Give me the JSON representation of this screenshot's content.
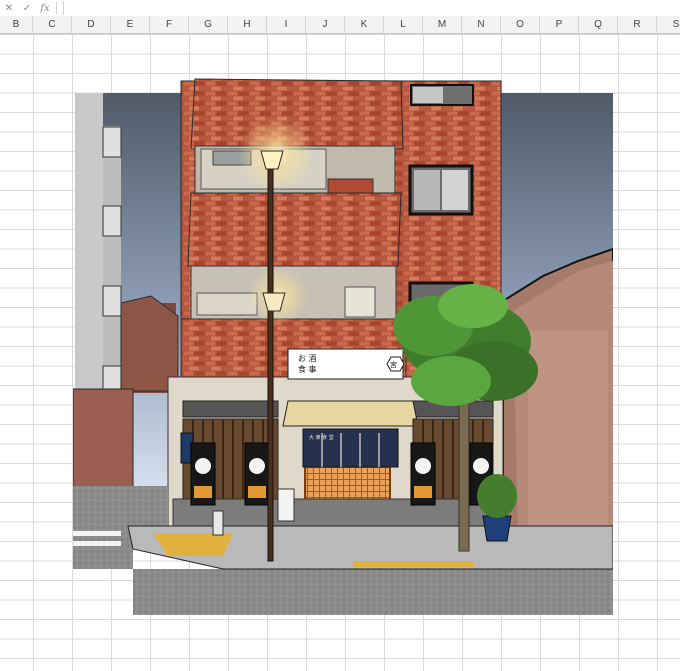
{
  "formula_bar": {
    "cancel_icon": "close-icon",
    "cancel_glyph": "✕",
    "confirm_icon": "check-icon",
    "confirm_glyph": "✓",
    "function_label": "fx",
    "content": ""
  },
  "columns": [
    "B",
    "C",
    "D",
    "E",
    "F",
    "G",
    "H",
    "I",
    "J",
    "K",
    "L",
    "M",
    "N",
    "O",
    "P",
    "Q",
    "R",
    "S"
  ],
  "artwork": {
    "shop_sign_line1": "お 酒",
    "shop_sign_line2": "食 事",
    "crest_symbol": "宮",
    "noren_text": "大 衆 食 堂",
    "colors": {
      "brick": "#b8513a",
      "sky_top": "#566170",
      "sky_bottom": "#c9d6e8",
      "lamp_glow": "#ffe9a0",
      "tree": "#3f7d2c"
    }
  }
}
